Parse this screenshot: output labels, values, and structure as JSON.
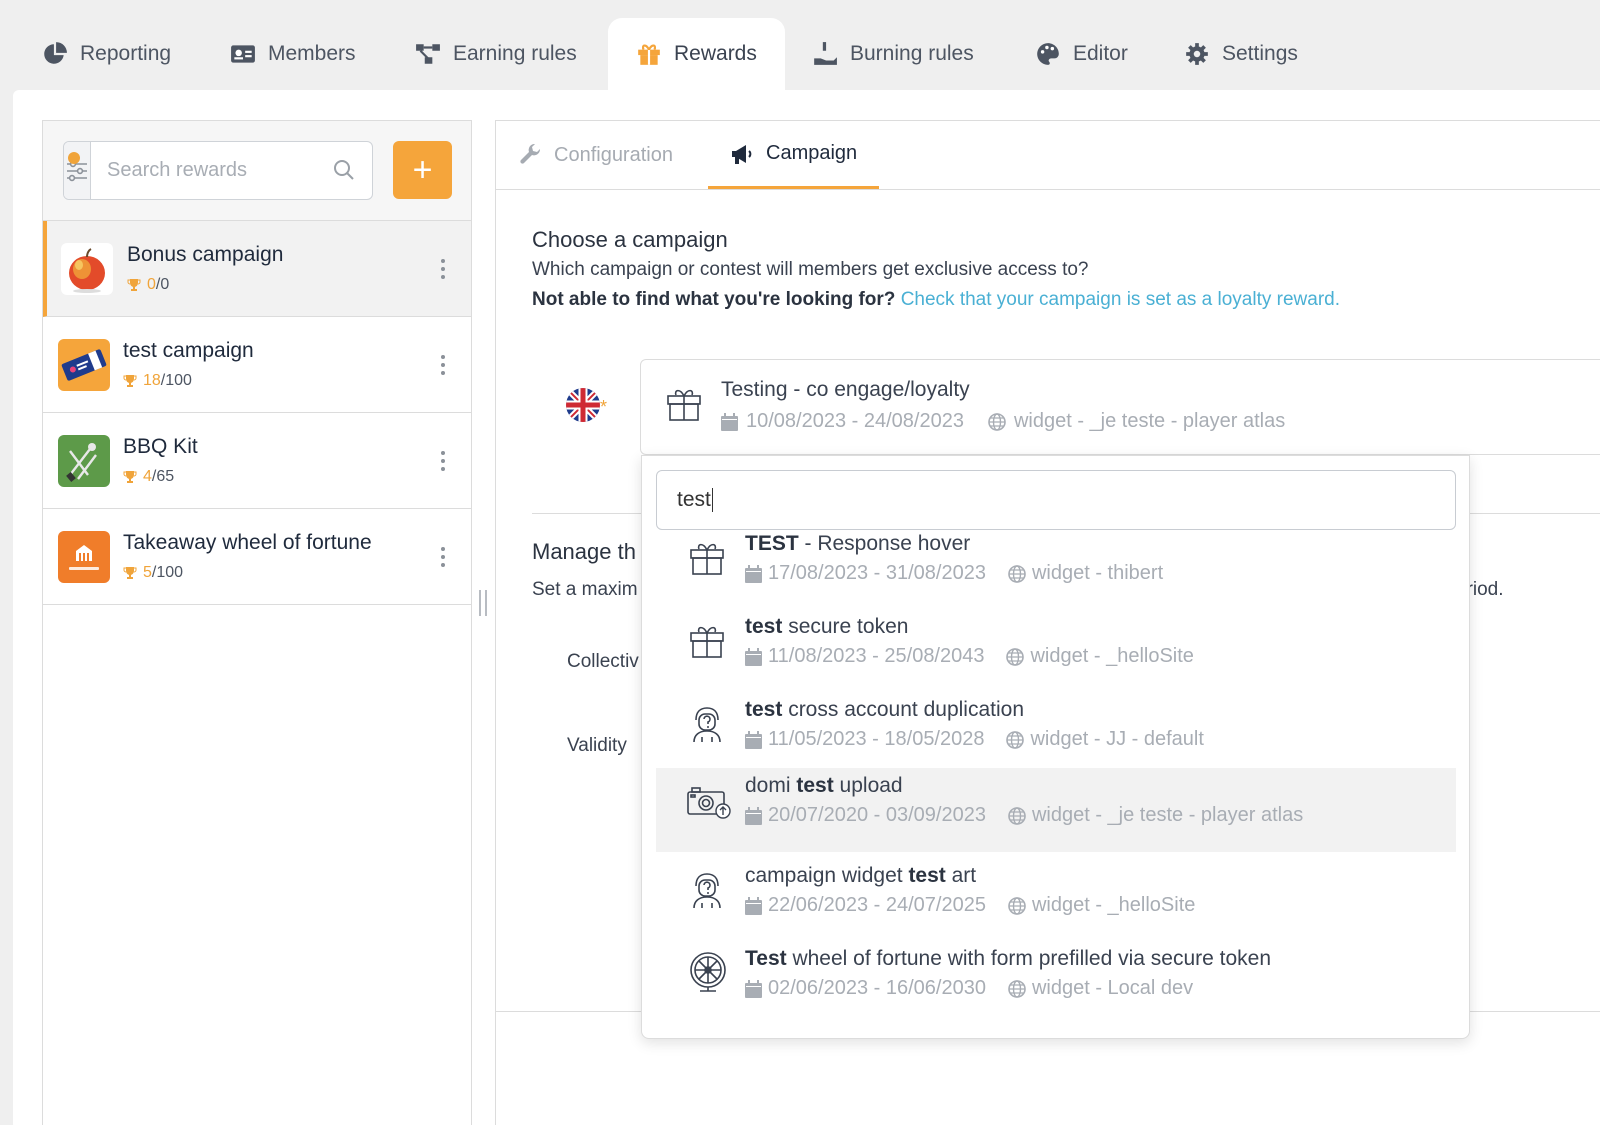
{
  "nav": {
    "tabs": [
      {
        "label": "Reporting",
        "icon": "pie-chart-icon"
      },
      {
        "label": "Members",
        "icon": "id-card-icon"
      },
      {
        "label": "Earning rules",
        "icon": "network-icon"
      },
      {
        "label": "Rewards",
        "icon": "gift-icon",
        "active": true
      },
      {
        "label": "Burning rules",
        "icon": "hand-coin-icon"
      },
      {
        "label": "Editor",
        "icon": "palette-icon"
      },
      {
        "label": "Settings",
        "icon": "gear-icon"
      }
    ]
  },
  "rewards": {
    "search_placeholder": "Search rewards",
    "add_label": "+",
    "items": [
      {
        "name": "Bonus campaign",
        "used": "0",
        "total": "/0",
        "selected": true
      },
      {
        "name": "test campaign",
        "used": "18",
        "total": "/100"
      },
      {
        "name": "BBQ Kit",
        "used": "4",
        "total": "/65"
      },
      {
        "name": "Takeaway wheel of fortune",
        "used": "5",
        "total": "/100"
      }
    ]
  },
  "content": {
    "tabs": {
      "configuration": "Configuration",
      "campaign": "Campaign"
    },
    "choose_title": "Choose a campaign",
    "choose_desc": "Which campaign or contest will members get exclusive access to?",
    "hint_bold": "Not able to find what you're looking for?",
    "hint_link": "Check that your campaign is set as a loyalty reward.",
    "selected": {
      "title": "Testing - co engage/loyalty",
      "dates": "10/08/2023 - 24/08/2023",
      "channel": "widget - _je teste - player atlas"
    },
    "manage_title": "Manage th",
    "manage_desc": "Set a maxim",
    "manage_desc_end": "eriod.",
    "collect_label": "Collectiv",
    "validity_label": "Validity",
    "flag_required": "*"
  },
  "dropdown": {
    "query": "test",
    "items": [
      {
        "bold": "TEST",
        "pre": "",
        "post": " - Response hover",
        "dates": "17/08/2023 - 31/08/2023",
        "channel": "widget - thibert",
        "icon": "gift-box-icon"
      },
      {
        "bold": "test",
        "pre": "",
        "post": " secure token",
        "dates": "11/08/2023 - 25/08/2043",
        "channel": "widget - _helloSite",
        "icon": "gift-box-icon"
      },
      {
        "bold": "test",
        "pre": "",
        "post": " cross account duplication",
        "dates": "11/05/2023 - 18/05/2028",
        "channel": "widget - JJ - default",
        "icon": "quiz-person-icon"
      },
      {
        "bold": "test",
        "pre": "domi ",
        "post": " upload",
        "dates": "20/07/2020 - 03/09/2023",
        "channel": "widget - _je teste - player atlas",
        "icon": "camera-upload-icon"
      },
      {
        "bold": "test",
        "pre": "campaign widget ",
        "post": " art",
        "dates": "22/06/2023 - 24/07/2025",
        "channel": "widget - _helloSite",
        "icon": "quiz-person-icon"
      },
      {
        "bold": "Test",
        "pre": "",
        "post": " wheel of fortune with form prefilled via secure token",
        "dates": "02/06/2023 - 16/06/2030",
        "channel": "widget - Local dev",
        "icon": "wheel-icon"
      }
    ]
  },
  "colors": {
    "accent": "#f5a53b",
    "link": "#4ab0d4",
    "muted": "#a8adb4"
  }
}
